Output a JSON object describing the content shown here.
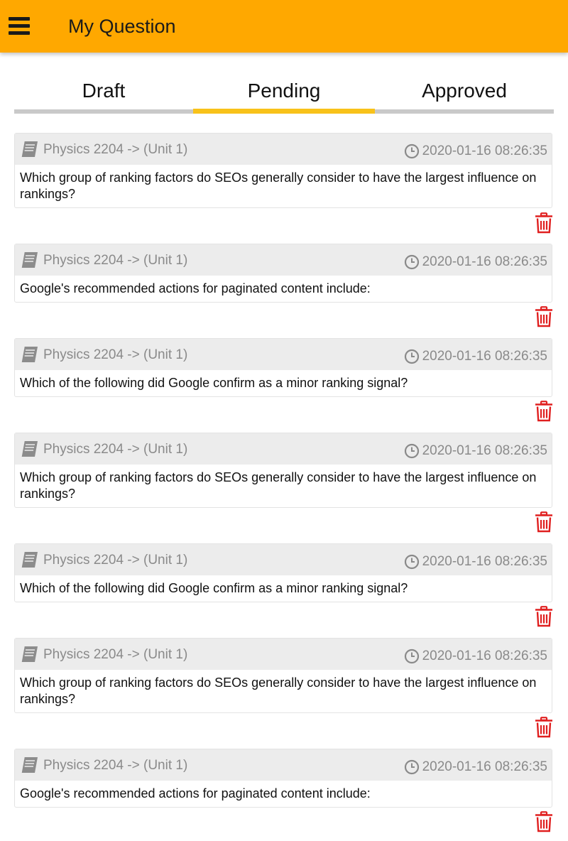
{
  "app_bar": {
    "title": "My Question",
    "menu_icon": "hamburger-menu-icon",
    "color": "#FFA800"
  },
  "tabs": [
    {
      "label": "Draft",
      "active": false
    },
    {
      "label": "Pending",
      "active": true
    },
    {
      "label": "Approved",
      "active": false
    }
  ],
  "colors": {
    "active_tab_indicator": "#F8C21A",
    "inactive_tab_indicator": "#C9C9C9",
    "delete_icon": "#E02020",
    "meta_text": "#8A8A8A"
  },
  "questions": [
    {
      "subject": "Physics 2204 -> (Unit 1)",
      "timestamp": "2020-01-16 08:26:35",
      "text": "Which group of ranking factors do SEOs generally consider to have the largest influence on rankings?"
    },
    {
      "subject": "Physics 2204 -> (Unit 1)",
      "timestamp": "2020-01-16 08:26:35",
      "text": "Google's recommended actions for paginated content include:"
    },
    {
      "subject": "Physics 2204 -> (Unit 1)",
      "timestamp": "2020-01-16 08:26:35",
      "text": "Which of the following did Google confirm as a minor ranking signal?"
    },
    {
      "subject": "Physics 2204 -> (Unit 1)",
      "timestamp": "2020-01-16 08:26:35",
      "text": "Which group of ranking factors do SEOs generally consider to have the largest influence on rankings?"
    },
    {
      "subject": "Physics 2204 -> (Unit 1)",
      "timestamp": "2020-01-16 08:26:35",
      "text": "Which of the following did Google confirm as a minor ranking signal?"
    },
    {
      "subject": "Physics 2204 -> (Unit 1)",
      "timestamp": "2020-01-16 08:26:35",
      "text": "Which group of ranking factors do SEOs generally consider to have the largest influence on rankings?"
    },
    {
      "subject": "Physics 2204 -> (Unit 1)",
      "timestamp": "2020-01-16 08:26:35",
      "text": "Google's recommended actions for paginated content include:"
    }
  ],
  "icons": {
    "subject": "book-icon",
    "time": "clock-icon",
    "delete": "trash-icon"
  }
}
